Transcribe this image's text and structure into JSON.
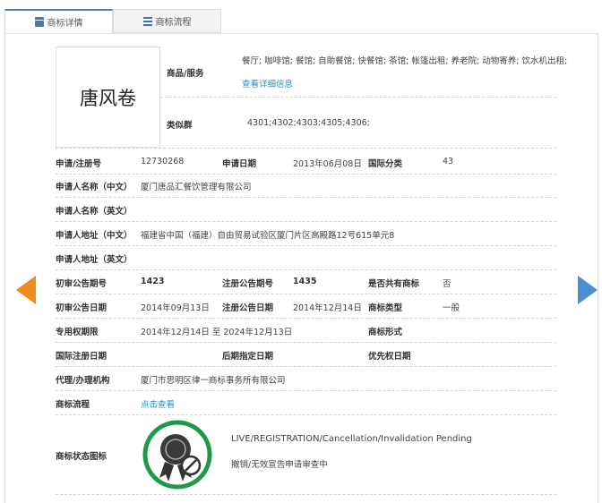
{
  "tabs": [
    {
      "label": "商标详情",
      "icon": "list-icon",
      "active": true
    },
    {
      "label": "商标流程",
      "icon": "grid-icon",
      "active": false
    }
  ],
  "trademark": {
    "name": "唐风卷"
  },
  "goods": {
    "label": "商品/服务",
    "value": "餐厅; 咖啡馆; 餐馆; 自助餐馆; 快餐馆; 茶馆; 帐篷出租; 养老院; 动物寄养; 饮水机出租;",
    "link": "查看详细信息"
  },
  "similar": {
    "label": "类似群",
    "value": "4301;4302;4303;4305;4306;"
  },
  "rows": {
    "reg_no": {
      "label": "申请/注册号",
      "value": "12730268"
    },
    "app_date": {
      "label": "申请日期",
      "value": "2013年06月08日"
    },
    "intl_class": {
      "label": "国际分类",
      "value": "43"
    },
    "applicant_cn": {
      "label": "申请人名称（中文）",
      "value": "厦门唐品汇餐饮管理有限公司"
    },
    "applicant_en": {
      "label": "申请人名称（英文）",
      "value": ""
    },
    "address_cn": {
      "label": "申请人地址（中文）",
      "value": "福建省中国（福建）自由贸易试验区厦门片区高殿路12号615单元8"
    },
    "address_en": {
      "label": "申请人地址（英文）",
      "value": ""
    },
    "prelim_no": {
      "label": "初审公告期号",
      "value": "1423"
    },
    "reg_pub_no": {
      "label": "注册公告期号",
      "value": "1435"
    },
    "shared": {
      "label": "是否共有商标",
      "value": "否"
    },
    "prelim_date": {
      "label": "初审公告日期",
      "value": "2014年09月13日"
    },
    "reg_pub_date": {
      "label": "注册公告日期",
      "value": "2014年12月14日"
    },
    "tm_type": {
      "label": "商标类型",
      "value": "一般"
    },
    "term": {
      "label": "专用权期限",
      "value": "2014年12月14日 至 2024年12月13日"
    },
    "tm_form": {
      "label": "商标形式",
      "value": ""
    },
    "intl_reg_date": {
      "label": "国际注册日期",
      "value": ""
    },
    "later_date": {
      "label": "后期指定日期",
      "value": ""
    },
    "priority_date": {
      "label": "优先权日期",
      "value": ""
    },
    "agent": {
      "label": "代理/办理机构",
      "value": "厦门市思明区律一商标事务所有限公司"
    },
    "flow": {
      "label": "商标流程",
      "value": "点击查看"
    }
  },
  "status": {
    "label": "商标状态图标",
    "en": "LIVE/REGISTRATION/Cancellation/Invalidation Pending",
    "cn": "撤销/无效宣告申请审查中",
    "ring_color": "#1e9a46"
  },
  "nav": {
    "prev_color": "#f08a1c",
    "next_color": "#4a8fd0"
  }
}
